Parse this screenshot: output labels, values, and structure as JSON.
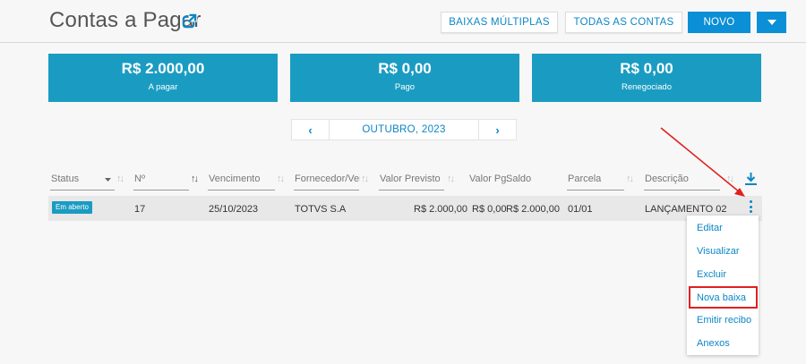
{
  "header": {
    "title": "Contas a Pagar",
    "buttons": {
      "baixas_multiplas": "BAIXAS MÚLTIPLAS",
      "todas_contas": "TODAS AS CONTAS",
      "novo": "NOVO"
    }
  },
  "summary_cards": [
    {
      "amount": "R$ 2.000,00",
      "label": "A pagar"
    },
    {
      "amount": "R$ 0,00",
      "label": "Pago"
    },
    {
      "amount": "R$ 0,00",
      "label": "Renegociado"
    }
  ],
  "month_nav": {
    "label": "OUTUBRO, 2023",
    "prev": "‹",
    "next": "›"
  },
  "table": {
    "columns": [
      "Status",
      "Nº",
      "Vencimento",
      "Fornecedor/Vend",
      "Valor Previsto",
      "Valor Pg.",
      "Saldo",
      "Parcela",
      "Descrição"
    ],
    "rows": [
      {
        "status": "Em aberto",
        "numero": "17",
        "vencimento": "25/10/2023",
        "fornecedor": "TOTVS S.A",
        "valor_previsto": "R$ 2.000,00",
        "valor_pago": "R$ 0,00",
        "saldo": "R$ 2.000,00",
        "parcela": "01/01",
        "descricao": "LANÇAMENTO 02"
      }
    ]
  },
  "row_menu": {
    "items": [
      "Editar",
      "Visualizar",
      "Excluir",
      "Nova baixa",
      "Emitir recibo",
      "Anexos"
    ],
    "highlighted": "Nova baixa"
  },
  "colors": {
    "accent": "#0b86c6",
    "card": "#1a9cc2",
    "annotation": "#e02020"
  },
  "icons": [
    "external-link-icon",
    "caret-down-icon",
    "download-icon",
    "kebab-menu-icon",
    "sort-icon"
  ]
}
